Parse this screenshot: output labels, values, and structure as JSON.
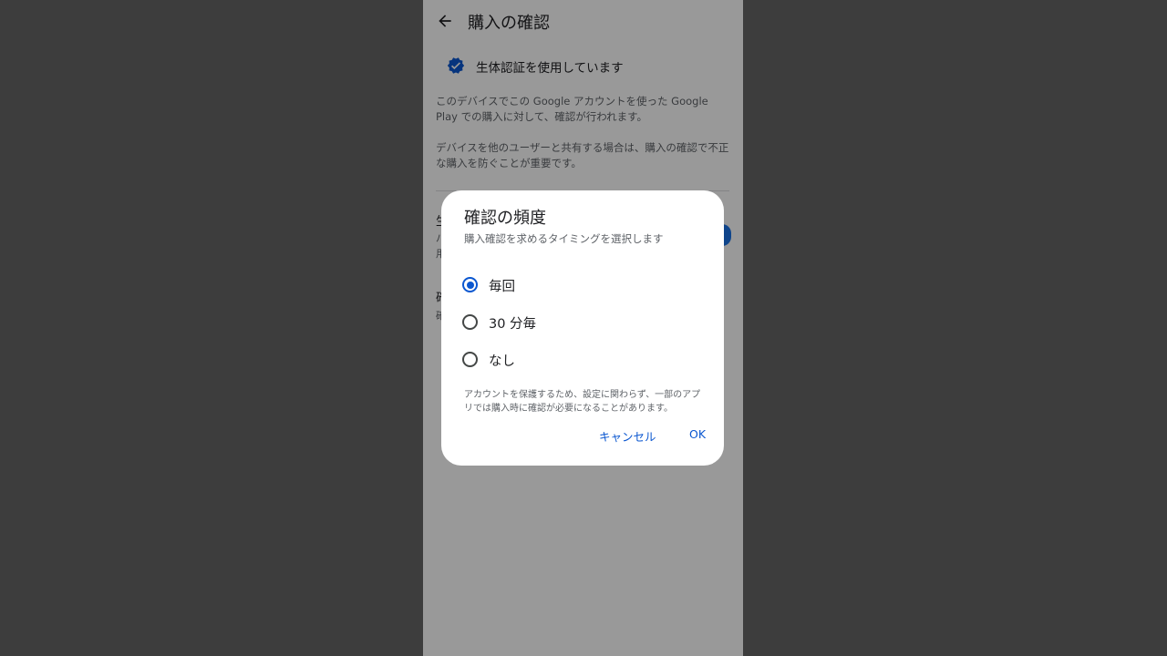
{
  "page": {
    "title": "購入の確認",
    "biometric_status": "生体認証を使用しています",
    "description_1": "このデバイスでこの Google アカウントを使った Google Play での購入に対して、確認が行われます。",
    "description_2": "デバイスを他のユーザーと共有する場合は、購入の確認で不正な購入を防ぐことが重要です。",
    "peek_texts": [
      "生",
      "パ",
      "用",
      "確",
      "確"
    ]
  },
  "dialog": {
    "title": "確認の頻度",
    "subtitle": "購入確認を求めるタイミングを選択します",
    "options": [
      {
        "label": "毎回",
        "selected": true
      },
      {
        "label": "30 分毎",
        "selected": false
      },
      {
        "label": "なし",
        "selected": false
      }
    ],
    "note": "アカウントを保護するため、設定に関わらず、一部のアプリでは購入時に確認が必要になることがあります。",
    "cancel_label": "キャンセル",
    "ok_label": "OK"
  },
  "colors": {
    "accent": "#0b57d0",
    "outer_background": "#3d3d3d",
    "scrim": "rgba(0,0,0,0.40)"
  },
  "icons": {
    "back": "arrow-back-icon",
    "verified": "verified-check-icon"
  }
}
